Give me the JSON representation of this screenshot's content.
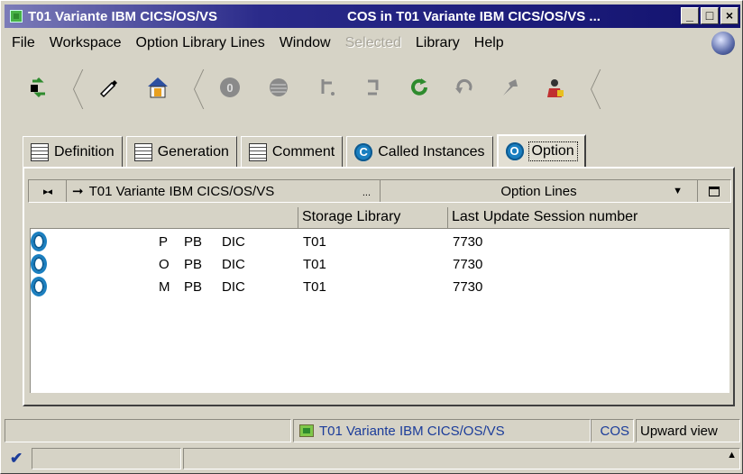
{
  "window": {
    "title_left": "T01 Variante IBM CICS/OS/VS",
    "title_right": "COS in T01 Variante IBM CICS/OS/VS ...",
    "controls": {
      "minimize": "_",
      "maximize": "□",
      "close": "×"
    }
  },
  "menu": {
    "items": [
      {
        "label": "File",
        "disabled": false
      },
      {
        "label": "Workspace",
        "disabled": false
      },
      {
        "label": "Option Library Lines",
        "disabled": false
      },
      {
        "label": "Window",
        "disabled": false
      },
      {
        "label": "Selected",
        "disabled": true
      },
      {
        "label": "Library",
        "disabled": false
      },
      {
        "label": "Help",
        "disabled": false
      }
    ]
  },
  "toolbar": {
    "icons": [
      "refresh-pair-icon",
      "pencil-icon",
      "library-house-icon",
      "zero-circle-icon",
      "ball-icon",
      "branch-icon",
      "arrows-icon",
      "green-cycle-icon",
      "undo-icon",
      "pin-icon",
      "person-icon"
    ]
  },
  "tabs": [
    {
      "label": "Definition",
      "icon": "list-icon",
      "active": false
    },
    {
      "label": "Generation",
      "icon": "list-icon",
      "active": false
    },
    {
      "label": "Comment",
      "icon": "list-icon",
      "active": false
    },
    {
      "label": "Called Instances",
      "icon": "c-icon",
      "icon_glyph": "C",
      "active": false
    },
    {
      "label": "Option",
      "icon": "o-icon",
      "icon_glyph": "O",
      "active": true
    }
  ],
  "panel": {
    "collapse_glyph": "▸◂",
    "path_arrow": "➞",
    "path": "T01 Variante IBM CICS/OS/VS",
    "path_more": "...",
    "view": "Option Lines",
    "dropdown_glyph": "▼"
  },
  "table": {
    "columns": [
      "",
      "Storage Library",
      "Last Update Session number"
    ],
    "rows": [
      {
        "c1": "P",
        "c2": "PB",
        "c3": "DIC",
        "library": "T01",
        "session": "7730"
      },
      {
        "c1": "O",
        "c2": "PB",
        "c3": "DIC",
        "library": "T01",
        "session": "7730"
      },
      {
        "c1": "M",
        "c2": "PB",
        "c3": "DIC",
        "library": "T01",
        "session": "7730"
      }
    ]
  },
  "status": {
    "variant": "T01 Variante IBM CICS/OS/VS",
    "cos": "COS",
    "view": "Upward view",
    "check": "✔",
    "scroll_glyph": "▲"
  },
  "colors": {
    "title_gradient_start": "#7c7cb8",
    "title_gradient_end": "#12126e",
    "accent_blue": "#1a7fc0",
    "status_text": "#1b3c9a",
    "face": "#d6d3c6"
  }
}
